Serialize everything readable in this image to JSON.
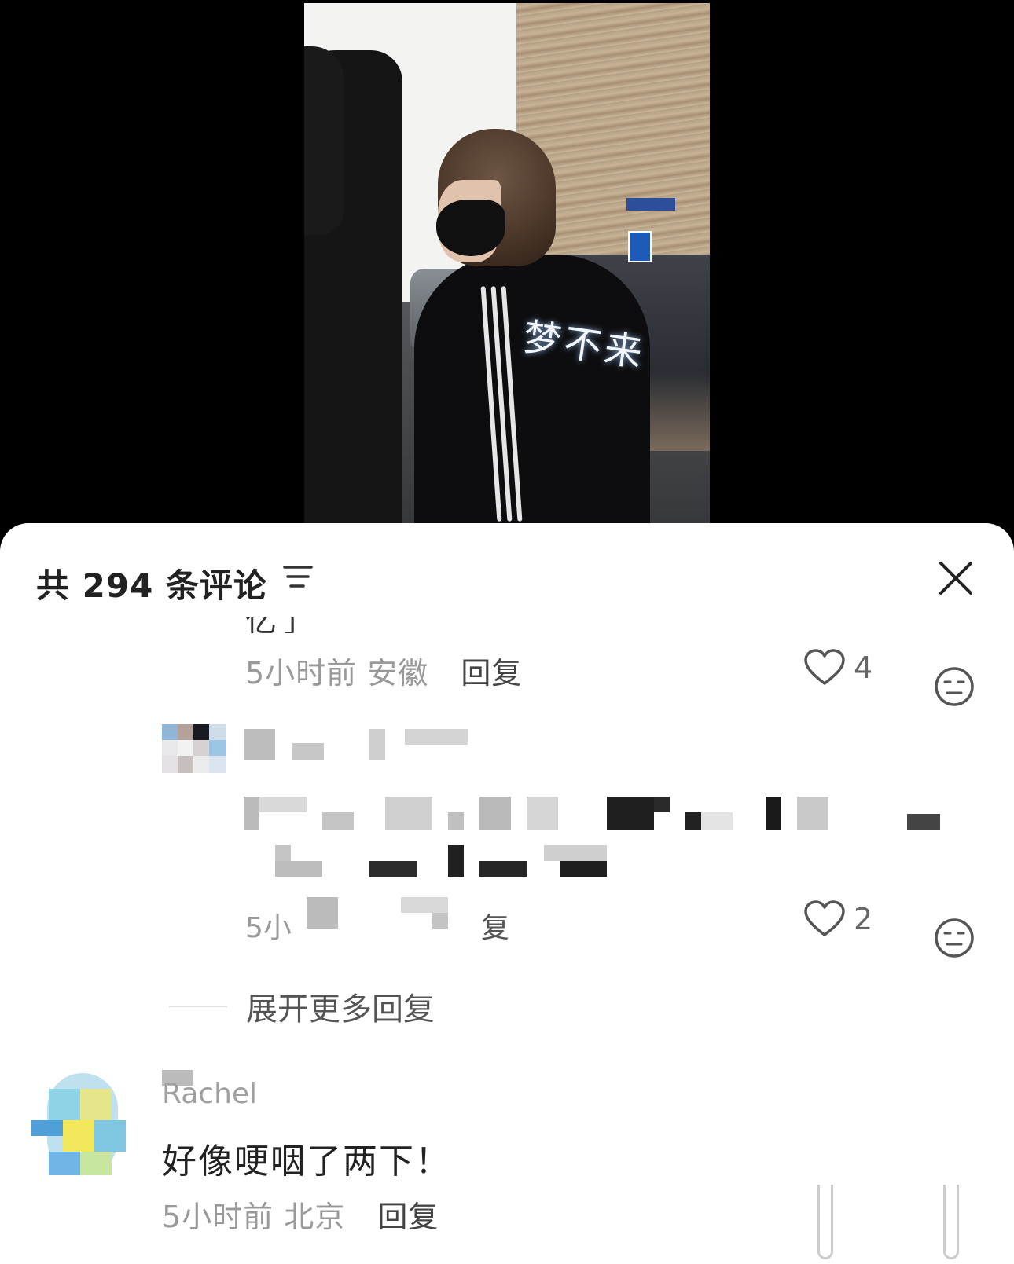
{
  "comments_sheet": {
    "count_label": "共 294 条评论",
    "filter_icon": "sort-lines-icon",
    "close_icon": "close-icon"
  },
  "reply_1": {
    "partial_text": "亿了",
    "time": "5小时前",
    "location": "安徽",
    "reply_label": "回复",
    "likes": "4"
  },
  "reply_2": {
    "likes": "2",
    "meta_partial": "5小",
    "reply_partial": "复"
  },
  "expand_more": "展开更多回复",
  "comment_3": {
    "username_partial": "Rachel",
    "text": "好像哽咽了两下！",
    "time": "5小时前",
    "location": "北京",
    "reply_label": "回复"
  },
  "calligraphy": "梦不来"
}
